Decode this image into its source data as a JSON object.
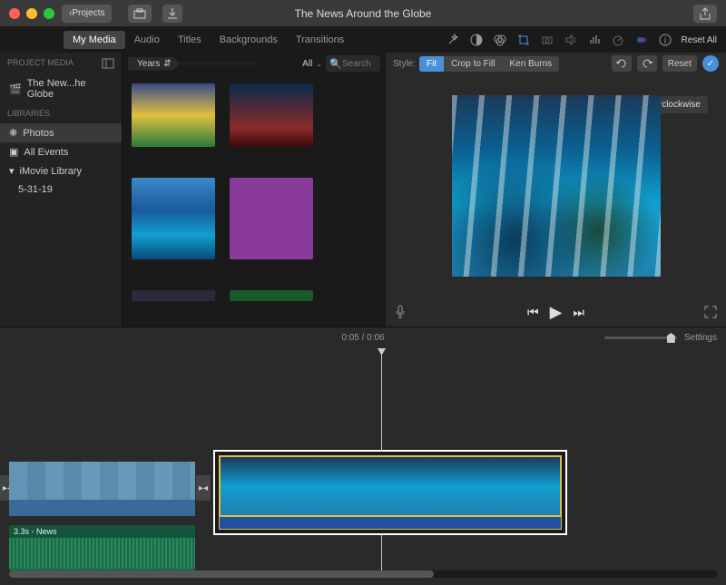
{
  "window": {
    "title": "The News Around the Globe"
  },
  "titlebar": {
    "back": "Projects"
  },
  "tabs": [
    "My Media",
    "Audio",
    "Titles",
    "Backgrounds",
    "Transitions"
  ],
  "activeTab": 0,
  "resetAll": "Reset All",
  "sidebar": {
    "heading1": "PROJECT MEDIA",
    "project": "The New...he Globe",
    "heading2": "LIBRARIES",
    "items": [
      "Photos",
      "All Events",
      "iMovie Library",
      "5-31-19"
    ]
  },
  "browser": {
    "crumb": "Years",
    "filter": "All",
    "searchPlaceholder": "Search"
  },
  "viewer": {
    "styleLabel": "Style:",
    "segs": [
      "Fit",
      "Crop to Fill",
      "Ken Burns"
    ],
    "activeSeg": 0,
    "resetLabel": "Reset",
    "tooltip": "Rotate the clip counterclockwise"
  },
  "time": {
    "current": "0:05",
    "total": "0:06",
    "settings": "Settings"
  },
  "audioClip": {
    "label": "3.3s - News"
  }
}
